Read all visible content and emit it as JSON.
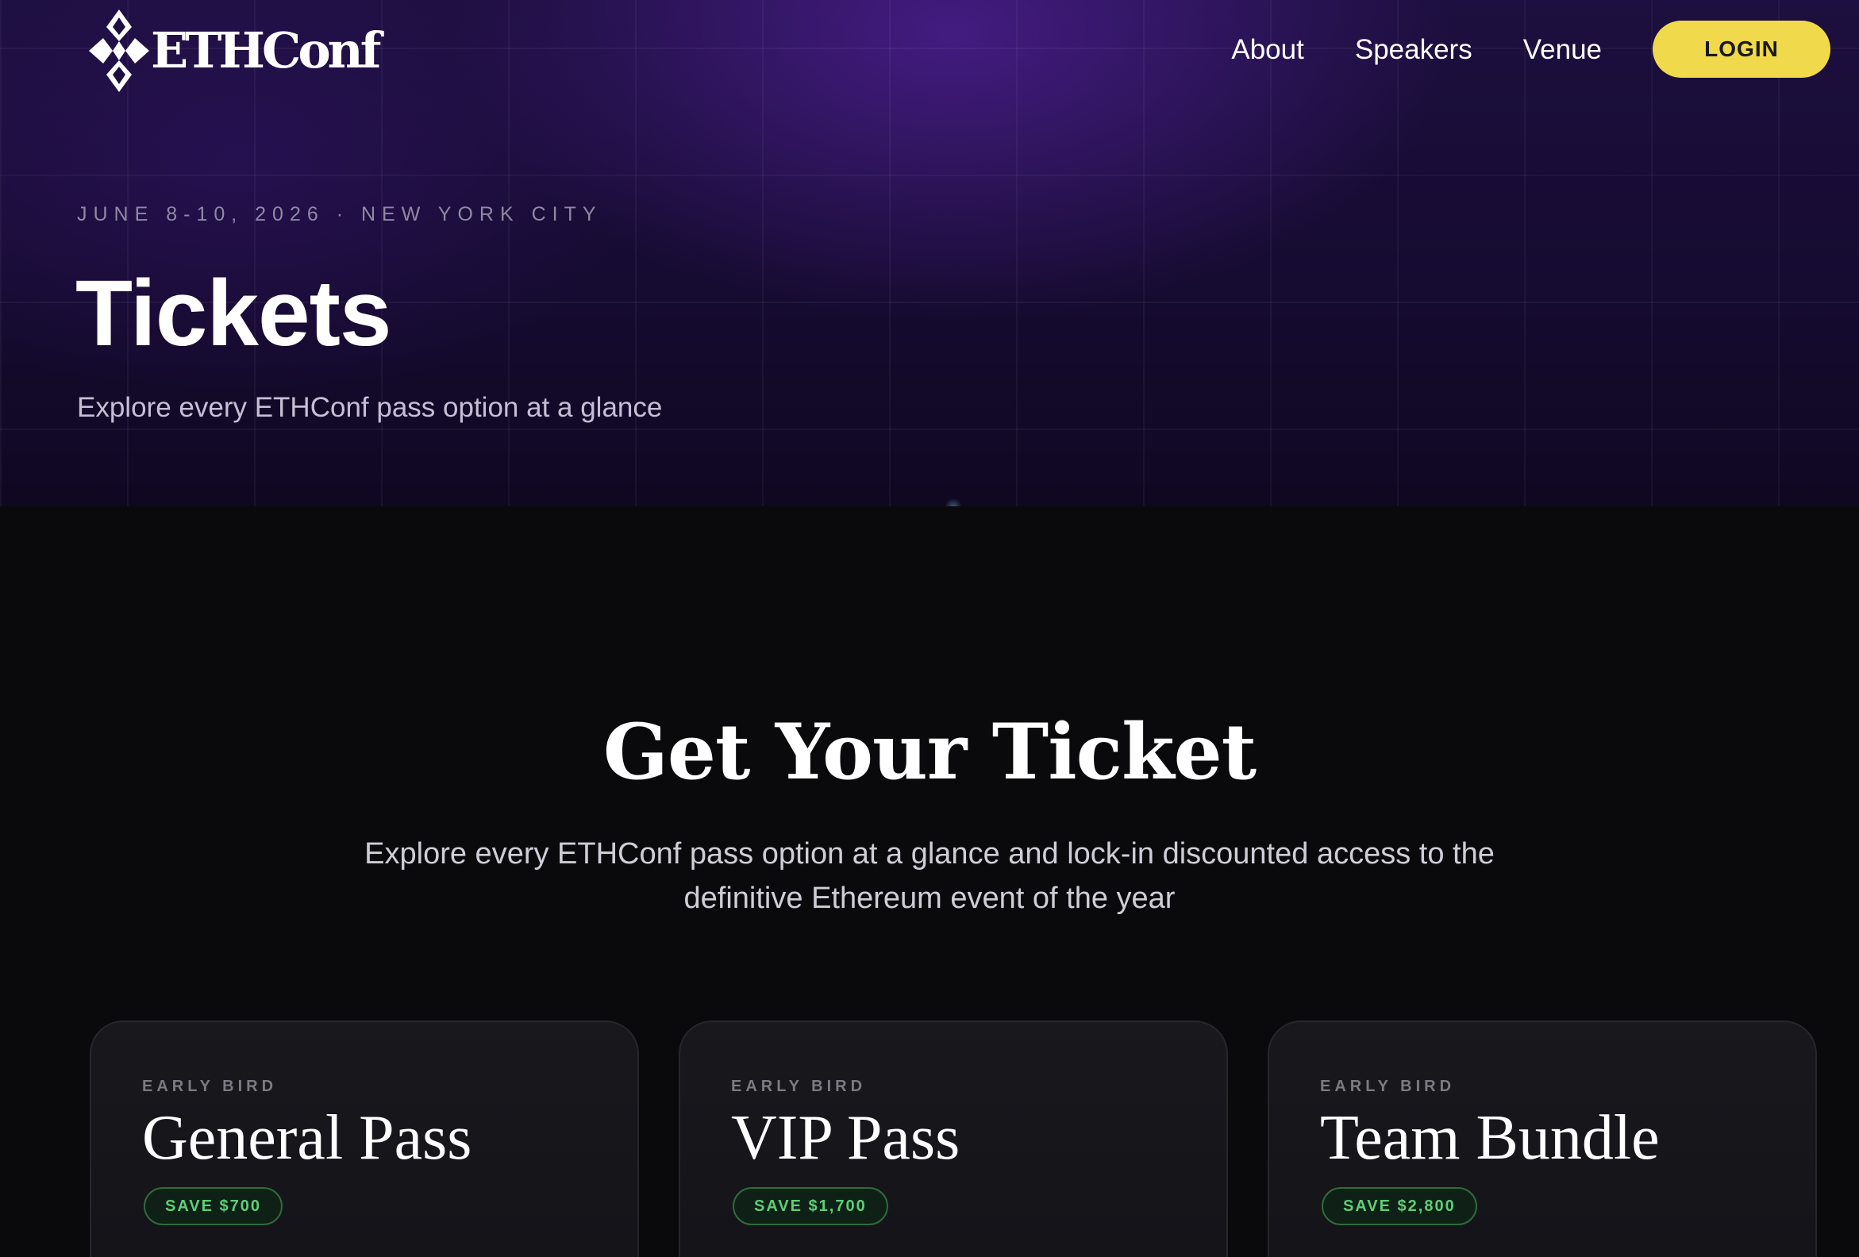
{
  "nav": {
    "logo_text": "ETHConf",
    "links": [
      "About",
      "Speakers",
      "Venue"
    ],
    "login_label": "LOGIN"
  },
  "hero": {
    "eyebrow": "JUNE 8-10, 2026 · NEW YORK CITY",
    "title": "Tickets",
    "subtitle": "Explore every ETHConf pass option at a glance"
  },
  "tickets_section": {
    "title": "Get Your Ticket",
    "subtitle": "Explore every ETHConf pass option at a glance and lock-in discounted access to the definitive Ethereum event of the year"
  },
  "cards": [
    {
      "eyebrow": "EARLY BIRD",
      "title": "General Pass",
      "badge": "SAVE $700"
    },
    {
      "eyebrow": "EARLY BIRD",
      "title": "VIP Pass",
      "badge": "SAVE $1,700"
    },
    {
      "eyebrow": "EARLY BIRD",
      "title": "Team Bundle",
      "badge": "SAVE $2,800"
    }
  ],
  "colors": {
    "accent": "#f0d94a",
    "badge_green": "#5ecf78",
    "hero_purple": "#1d0f3f",
    "background": "#0a0a0c"
  },
  "icons": {
    "logo": "ethconf-logo-icon"
  }
}
